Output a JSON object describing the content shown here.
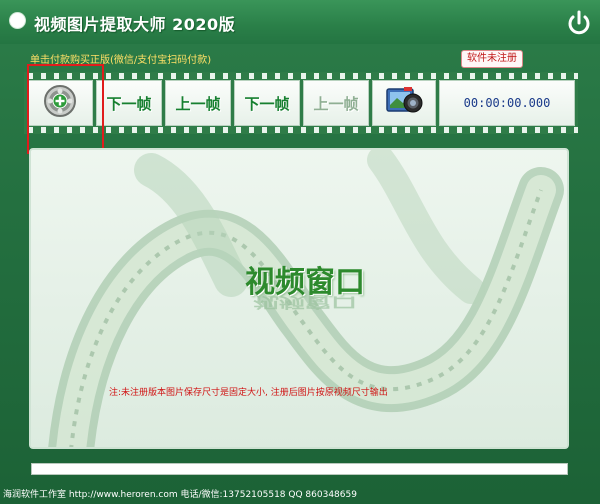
{
  "window": {
    "title": "视频图片提取大师  2020版"
  },
  "header": {
    "buy_link": "单击付款购买正版(微信/支付宝扫码付款)",
    "registration_badge": "软件未注册"
  },
  "toolbar": {
    "add_file_icon": "film-reel-plus-icon",
    "next_frame_label": "下一帧",
    "prev_frame_label": "上一帧",
    "next_frame_label_2": "下一帧",
    "prev_frame_label_2": "上一帧",
    "snapshot_icon": "camera-film-icon",
    "timecode": "00:00:00.000"
  },
  "video": {
    "window_label": "视频窗口",
    "note": "注:未注册版本图片保存尺寸是固定大小, 注册后图片按原视频尺寸输出"
  },
  "progress": {
    "value": 0
  },
  "status_bar": {
    "text": "海润软件工作室 http://www.heroren.com 电话/微信:13752105518  QQ 860348659"
  },
  "colors": {
    "background": "#247040",
    "accent_green": "#178030",
    "warning_red": "#d01414",
    "timecode_blue": "#1a3a8a",
    "buy_link_yellow": "#ffe066"
  }
}
